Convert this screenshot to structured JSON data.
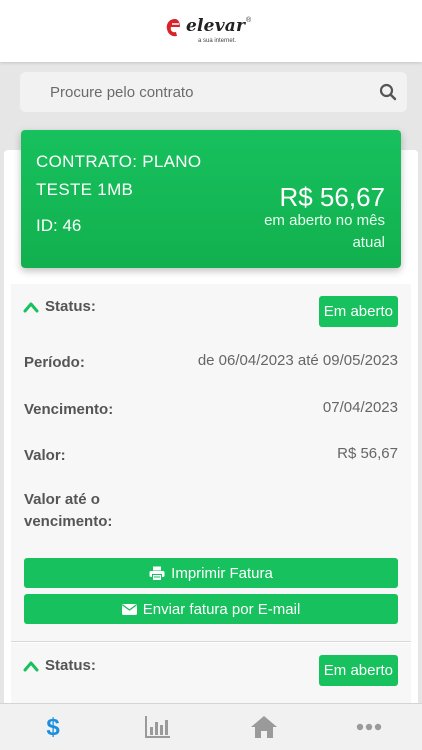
{
  "header": {
    "logo_text": "elevar",
    "logo_tagline": "a sua internet."
  },
  "search": {
    "placeholder": "Procure pelo contrato"
  },
  "contract": {
    "title": "CONTRATO: PLANO TESTE 1MB",
    "id_label": "ID: 46",
    "amount": "R$ 56,67",
    "amount_label": "em aberto no mês atual"
  },
  "invoices": [
    {
      "status_label": "Status:",
      "status_value": "Em aberto",
      "period_label": "Período:",
      "period_value": "de 06/04/2023 até 09/05/2023",
      "due_label": "Vencimento:",
      "due_value": "07/04/2023",
      "value_label": "Valor:",
      "value_value": "R$ 56,67",
      "value_until_due_label": "Valor até o vencimento:",
      "print_button": "Imprimir Fatura",
      "email_button": "Enviar fatura por E-mail"
    },
    {
      "status_label": "Status:",
      "status_value": "Em aberto"
    }
  ],
  "bottom_nav": [
    {
      "icon": "dollar-icon",
      "active": true
    },
    {
      "icon": "bar-chart-icon",
      "active": false
    },
    {
      "icon": "home-icon",
      "active": false
    },
    {
      "icon": "more-icon",
      "active": false
    }
  ],
  "colors": {
    "accent": "#17c15d",
    "active_nav": "#1a8fe0",
    "inactive_nav": "#9a9a9a"
  }
}
